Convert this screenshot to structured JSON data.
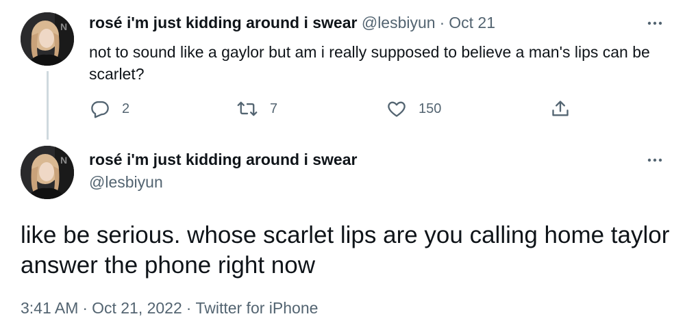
{
  "tweet1": {
    "display_name": "rosé i'm just kidding around i swear",
    "handle": "@lesbiyun",
    "separator": "·",
    "date": "Oct 21",
    "text": "not to sound like a gaylor but am i really supposed to believe a man's lips can be scarlet?",
    "actions": {
      "reply_count": "2",
      "retweet_count": "7",
      "like_count": "150"
    },
    "icons": [
      "more-icon",
      "reply-icon",
      "retweet-icon",
      "like-icon",
      "share-icon"
    ]
  },
  "tweet2": {
    "display_name": "rosé i'm just kidding around i swear",
    "handle": "@lesbiyun",
    "text": "like be serious. whose scarlet lips are you calling home taylor answer the phone right now",
    "meta": {
      "time": "3:41 AM",
      "separator": "·",
      "date": "Oct 21, 2022",
      "source": "Twitter for iPhone"
    }
  },
  "colors": {
    "text": "#0f1419",
    "secondary": "#536471",
    "thread_line": "#cfd9de",
    "background": "#ffffff"
  }
}
